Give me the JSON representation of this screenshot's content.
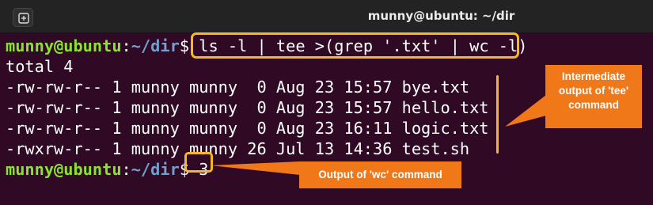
{
  "window": {
    "title": "munny@ubuntu: ~/dir",
    "new_tab_icon": "new-tab-icon"
  },
  "terminal": {
    "prompt": {
      "user": "munny@ubuntu",
      "sep": ":",
      "path": "~/dir",
      "symbol": "$"
    },
    "command": "ls -l | tee >(grep '.txt' | wc -l)",
    "output": [
      "total 4",
      "-rw-rw-r-- 1 munny munny  0 Aug 23 15:57 bye.txt",
      "-rw-rw-r-- 1 munny munny  0 Aug 23 15:57 hello.txt",
      "-rw-rw-r-- 1 munny munny  0 Aug 23 16:11 logic.txt",
      "-rwxrw-r-- 1 munny munny 26 Jul 13 14:36 test.sh"
    ],
    "wc_output": "3"
  },
  "annotations": {
    "tee_output": "Intermediate output of 'tee' command",
    "wc_output": "Output of 'wc' command",
    "highlight_color": "#f6b81a",
    "callout_color": "#f07818"
  }
}
